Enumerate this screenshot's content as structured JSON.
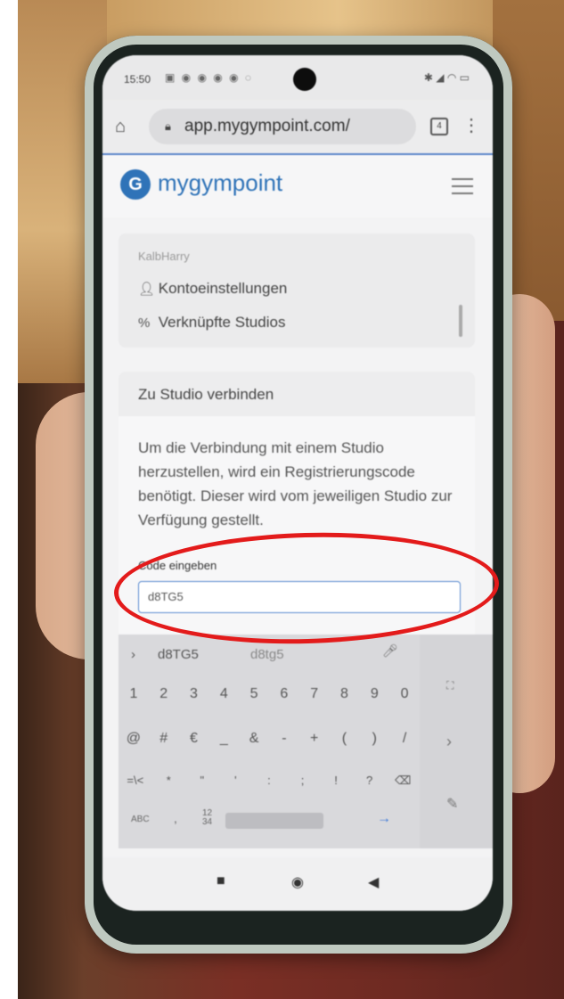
{
  "status_bar": {
    "time": "15:50",
    "icons": "▣ ◉ ◉ ◉ ◉ ◌",
    "right": "✱ ◢ ◠ ▭"
  },
  "browser": {
    "url": "app.mygympoint.com/",
    "tabs_count": "4"
  },
  "app": {
    "brand": "mygympoint",
    "brand_color": "#2f73b8"
  },
  "account": {
    "username": "KalbHarry",
    "items": [
      {
        "icon": "user-icon",
        "label": "Kontoeinstellungen"
      },
      {
        "icon": "link-icon",
        "label": "Verknüpfte Studios"
      }
    ]
  },
  "connect": {
    "title": "Zu Studio verbinden",
    "info": "Um die Verbindung mit einem Studio herzustellen, wird ein Registrierungscode benötigt. Dieser wird vom jeweiligen Studio zur Verfügung gestellt.",
    "code_label": "Code eingeben",
    "code_value": "d8TG5"
  },
  "keyboard": {
    "suggestions": [
      "d8TG5",
      "d8tg5"
    ],
    "rows": [
      [
        "1",
        "2",
        "3",
        "4",
        "5",
        "6",
        "7",
        "8",
        "9",
        "0"
      ],
      [
        "@",
        "#",
        "€",
        "_",
        "&",
        "-",
        "+",
        "(",
        ")",
        "/"
      ],
      [
        "=\\<",
        "*",
        "\"",
        "'",
        ":",
        ";",
        "!",
        "?",
        "⌫"
      ]
    ],
    "bottom": {
      "abc": "ABC",
      "dot": ",",
      "num_top": "12",
      "num_bottom": "34",
      "enter": "→"
    }
  },
  "annotation_color": "#e31b1b"
}
